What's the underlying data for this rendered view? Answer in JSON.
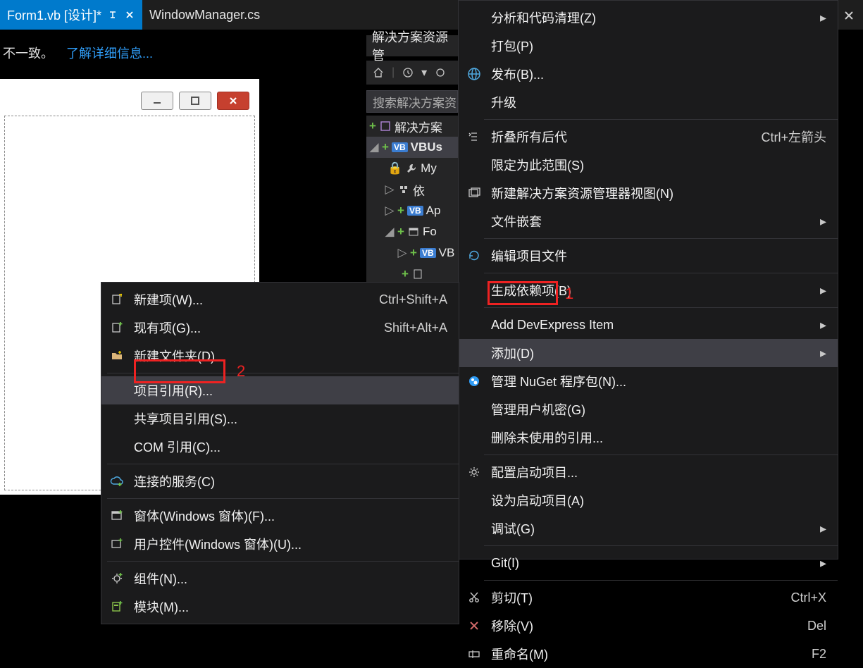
{
  "tabs": {
    "active": "Form1.vb [设计]*",
    "inactive": "WindowManager.cs"
  },
  "infobar": {
    "text": "不一致。",
    "link": "了解详细信息..."
  },
  "solution": {
    "title": "解决方案资源管",
    "search": "搜索解决方案资",
    "rows": {
      "sol": "解决方案",
      "proj": "VBUs",
      "my": "My",
      "deps": "依",
      "app": "Ap",
      "form": "Fo",
      "vb": "VB"
    }
  },
  "mainMenu": {
    "analyze": "分析和代码清理(Z)",
    "pack": "打包(P)",
    "publish": "发布(B)...",
    "upgrade": "升级",
    "collapse": "折叠所有后代",
    "collapse_sc": "Ctrl+左箭头",
    "scope": "限定为此范围(S)",
    "newview": "新建解决方案资源管理器视图(N)",
    "nesting": "文件嵌套",
    "editproj": "编辑项目文件",
    "builddep": "生成依赖项(B)",
    "devexpress": "Add DevExpress Item",
    "add": "添加(D)",
    "nuget": "管理 NuGet 程序包(N)...",
    "secrets": "管理用户机密(G)",
    "removeunused": "删除未使用的引用...",
    "startupconfig": "配置启动项目...",
    "setstartup": "设为启动项目(A)",
    "debug": "调试(G)",
    "git": "Git(I)",
    "cut": "剪切(T)",
    "cut_sc": "Ctrl+X",
    "remove": "移除(V)",
    "remove_sc": "Del",
    "rename": "重命名(M)",
    "rename_sc": "F2"
  },
  "subMenu": {
    "newitem": "新建项(W)...",
    "newitem_sc": "Ctrl+Shift+A",
    "existing": "现有项(G)...",
    "existing_sc": "Shift+Alt+A",
    "newfolder": "新建文件夹(D)",
    "projref": "项目引用(R)...",
    "sharedref": "共享项目引用(S)...",
    "comref": "COM 引用(C)...",
    "connected": "连接的服务(C)",
    "winform": "窗体(Windows 窗体)(F)...",
    "usercontrol": "用户控件(Windows 窗体)(U)...",
    "component": "组件(N)...",
    "module": "模块(M)..."
  },
  "annot": {
    "one": "1",
    "two": "2"
  }
}
